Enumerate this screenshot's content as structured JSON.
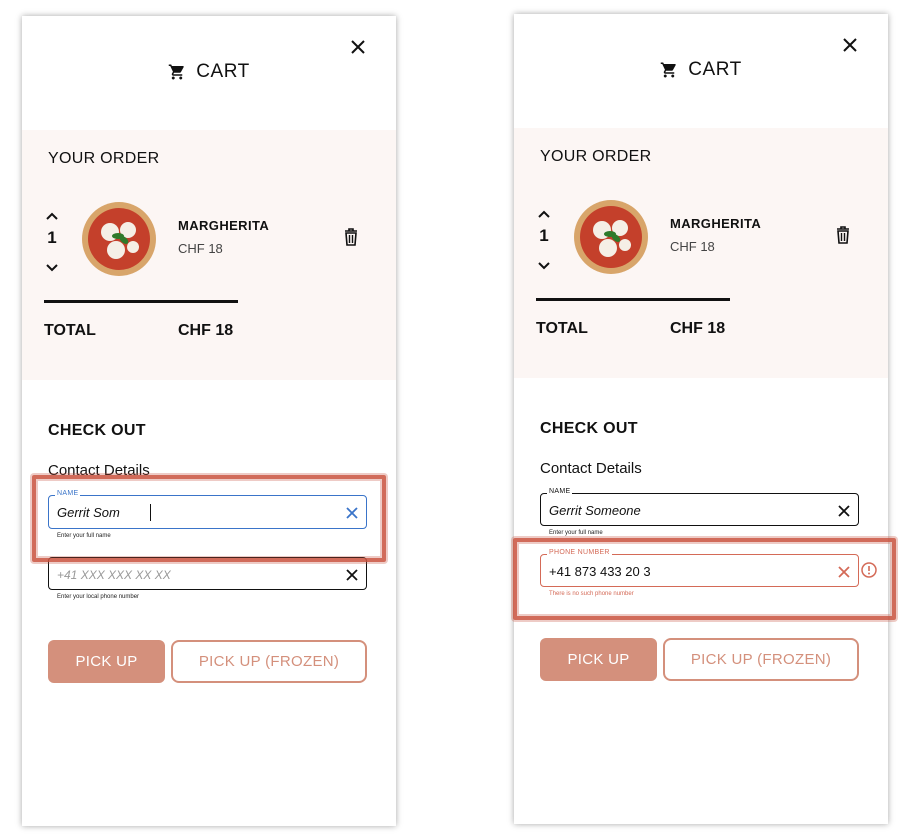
{
  "colors": {
    "accent": "#d4907c",
    "focus": "#3a74c9",
    "error": "#d46a57",
    "order_bg": "#fcf6f4",
    "highlight": "#c9523e"
  },
  "left": {
    "title": "CART",
    "order_heading": "YOUR ORDER",
    "item": {
      "quantity": "1",
      "name": "MARGHERITA",
      "price": "CHF 18"
    },
    "total_label": "TOTAL",
    "total_value": "CHF 18",
    "checkout_heading": "CHECK OUT",
    "contact_heading": "Contact Details",
    "name_field": {
      "label": "NAME",
      "value": "Gerrit Som",
      "helper": "Enter your full name"
    },
    "phone_field": {
      "placeholder": "+41 XXX XXX XX XX",
      "helper": "Enter your local phone number"
    },
    "pickup_label": "PICK UP",
    "pickup_frozen_label": "PICK UP (FROZEN)"
  },
  "right": {
    "title": "CART",
    "order_heading": "YOUR ORDER",
    "item": {
      "quantity": "1",
      "name": "MARGHERITA",
      "price": "CHF 18"
    },
    "total_label": "TOTAL",
    "total_value": "CHF 18",
    "checkout_heading": "CHECK OUT",
    "contact_heading": "Contact Details",
    "name_field": {
      "label": "NAME",
      "value": "Gerrit Someone",
      "helper": "Enter your full name"
    },
    "phone_field": {
      "label": "PHONE NUMBER",
      "value": "+41 873 433 20 3",
      "helper": "There is no such phone number"
    },
    "pickup_label": "PICK UP",
    "pickup_frozen_label": "PICK UP (FROZEN)"
  }
}
